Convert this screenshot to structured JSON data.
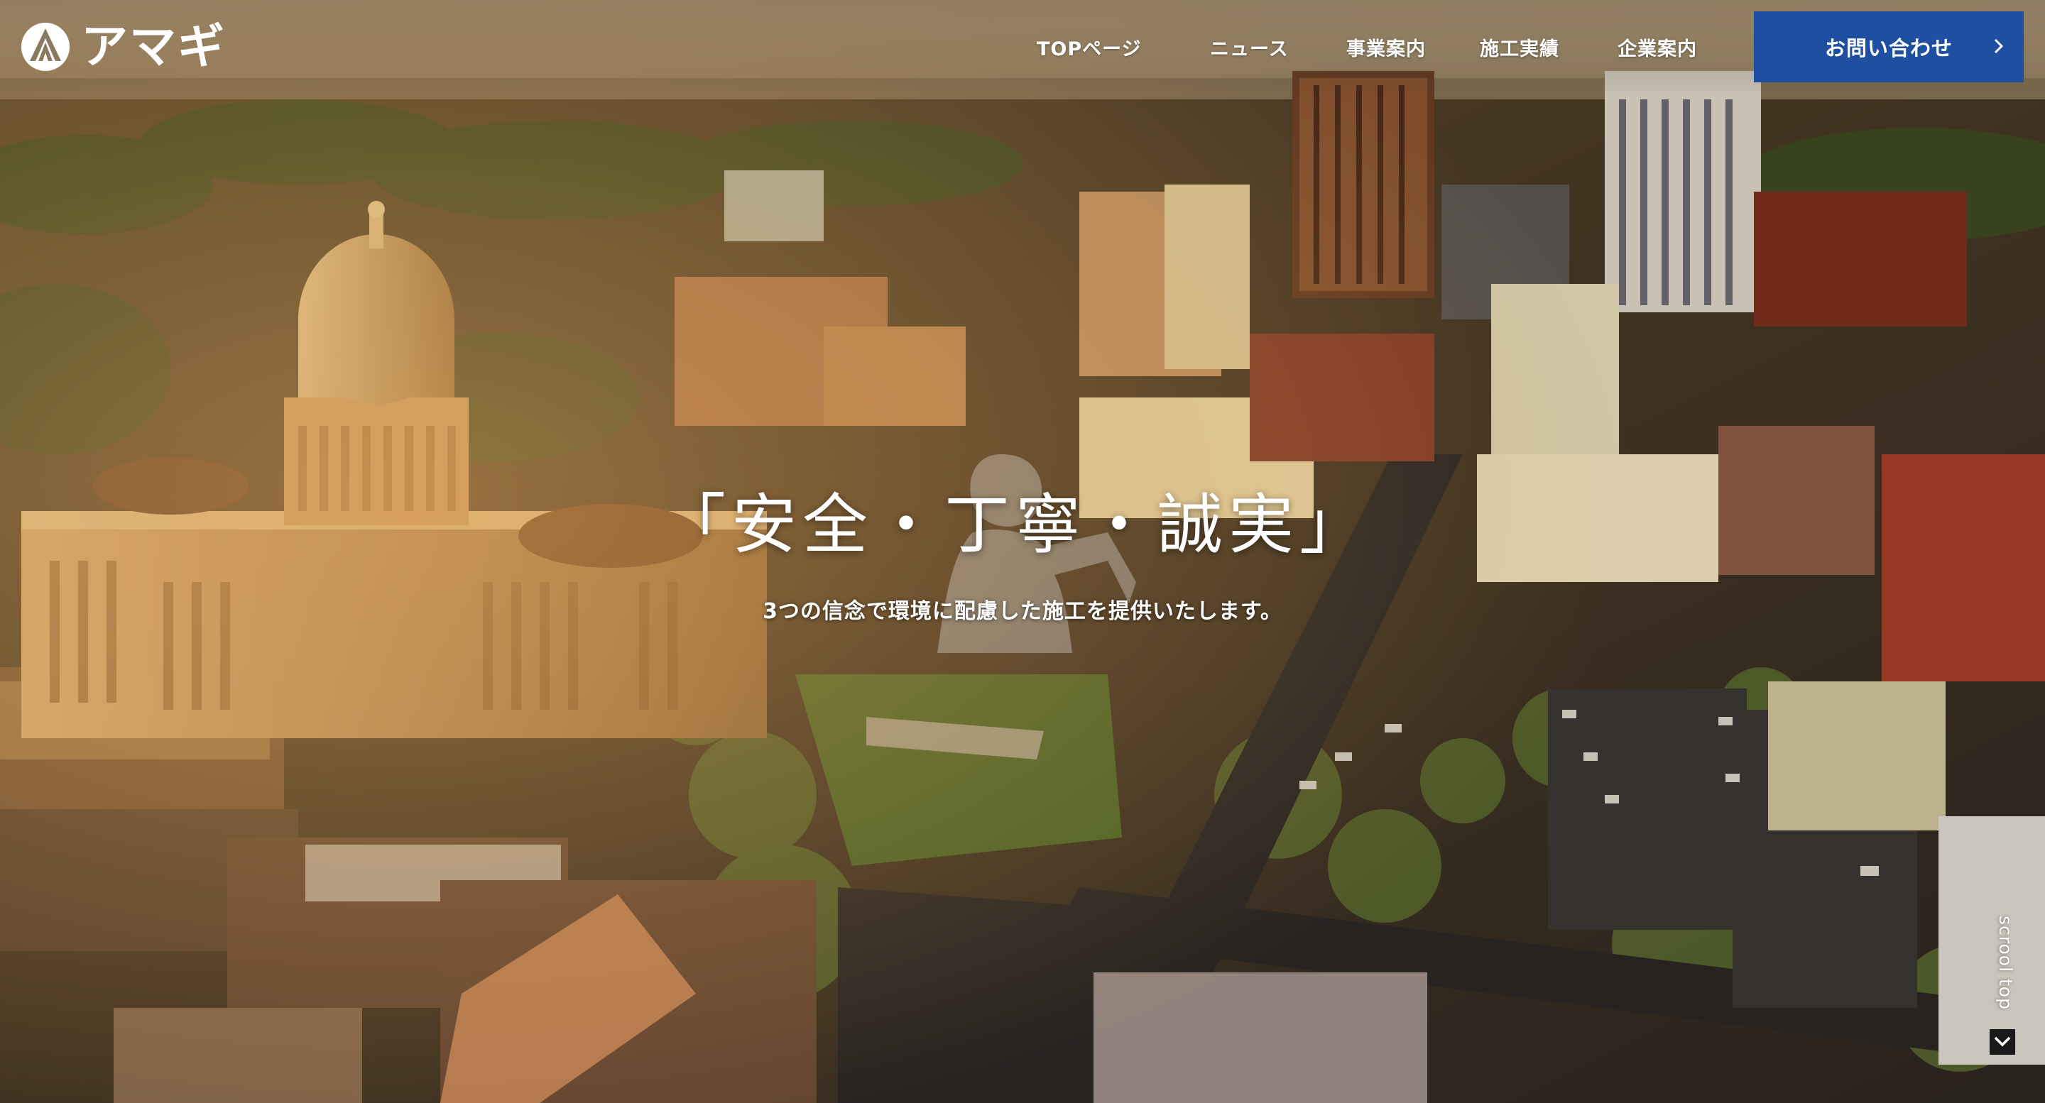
{
  "brand": {
    "name": "アマギ",
    "logo_icon": "a-triangle-logo-icon"
  },
  "nav": {
    "items": [
      {
        "label": "TOPページ"
      },
      {
        "label": "ニュース"
      },
      {
        "label": "事業案内"
      },
      {
        "label": "施工実績"
      },
      {
        "label": "企業案内"
      }
    ]
  },
  "contact": {
    "label": "お問い合わせ",
    "icon": "chevron-right-icon",
    "color": "#1f4fa0"
  },
  "hero": {
    "headline": "「安全・丁寧・誠実」",
    "subline": "3つの信念で環境に配慮した施工を提供いたします。",
    "overlay_icon": "worker-silhouette-icon"
  },
  "scroll": {
    "label": "scrool top",
    "icon": "chevron-down-icon"
  }
}
